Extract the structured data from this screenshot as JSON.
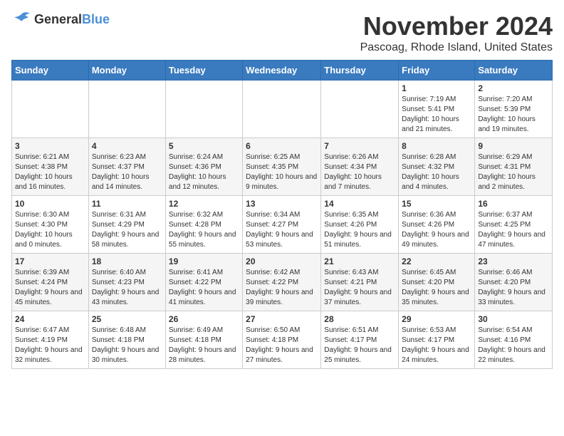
{
  "header": {
    "logo_general": "General",
    "logo_blue": "Blue",
    "month_title": "November 2024",
    "location": "Pascoag, Rhode Island, United States"
  },
  "weekdays": [
    "Sunday",
    "Monday",
    "Tuesday",
    "Wednesday",
    "Thursday",
    "Friday",
    "Saturday"
  ],
  "weeks": [
    [
      {
        "day": "",
        "info": ""
      },
      {
        "day": "",
        "info": ""
      },
      {
        "day": "",
        "info": ""
      },
      {
        "day": "",
        "info": ""
      },
      {
        "day": "",
        "info": ""
      },
      {
        "day": "1",
        "info": "Sunrise: 7:19 AM\nSunset: 5:41 PM\nDaylight: 10 hours and 21 minutes."
      },
      {
        "day": "2",
        "info": "Sunrise: 7:20 AM\nSunset: 5:39 PM\nDaylight: 10 hours and 19 minutes."
      }
    ],
    [
      {
        "day": "3",
        "info": "Sunrise: 6:21 AM\nSunset: 4:38 PM\nDaylight: 10 hours and 16 minutes."
      },
      {
        "day": "4",
        "info": "Sunrise: 6:23 AM\nSunset: 4:37 PM\nDaylight: 10 hours and 14 minutes."
      },
      {
        "day": "5",
        "info": "Sunrise: 6:24 AM\nSunset: 4:36 PM\nDaylight: 10 hours and 12 minutes."
      },
      {
        "day": "6",
        "info": "Sunrise: 6:25 AM\nSunset: 4:35 PM\nDaylight: 10 hours and 9 minutes."
      },
      {
        "day": "7",
        "info": "Sunrise: 6:26 AM\nSunset: 4:34 PM\nDaylight: 10 hours and 7 minutes."
      },
      {
        "day": "8",
        "info": "Sunrise: 6:28 AM\nSunset: 4:32 PM\nDaylight: 10 hours and 4 minutes."
      },
      {
        "day": "9",
        "info": "Sunrise: 6:29 AM\nSunset: 4:31 PM\nDaylight: 10 hours and 2 minutes."
      }
    ],
    [
      {
        "day": "10",
        "info": "Sunrise: 6:30 AM\nSunset: 4:30 PM\nDaylight: 10 hours and 0 minutes."
      },
      {
        "day": "11",
        "info": "Sunrise: 6:31 AM\nSunset: 4:29 PM\nDaylight: 9 hours and 58 minutes."
      },
      {
        "day": "12",
        "info": "Sunrise: 6:32 AM\nSunset: 4:28 PM\nDaylight: 9 hours and 55 minutes."
      },
      {
        "day": "13",
        "info": "Sunrise: 6:34 AM\nSunset: 4:27 PM\nDaylight: 9 hours and 53 minutes."
      },
      {
        "day": "14",
        "info": "Sunrise: 6:35 AM\nSunset: 4:26 PM\nDaylight: 9 hours and 51 minutes."
      },
      {
        "day": "15",
        "info": "Sunrise: 6:36 AM\nSunset: 4:26 PM\nDaylight: 9 hours and 49 minutes."
      },
      {
        "day": "16",
        "info": "Sunrise: 6:37 AM\nSunset: 4:25 PM\nDaylight: 9 hours and 47 minutes."
      }
    ],
    [
      {
        "day": "17",
        "info": "Sunrise: 6:39 AM\nSunset: 4:24 PM\nDaylight: 9 hours and 45 minutes."
      },
      {
        "day": "18",
        "info": "Sunrise: 6:40 AM\nSunset: 4:23 PM\nDaylight: 9 hours and 43 minutes."
      },
      {
        "day": "19",
        "info": "Sunrise: 6:41 AM\nSunset: 4:22 PM\nDaylight: 9 hours and 41 minutes."
      },
      {
        "day": "20",
        "info": "Sunrise: 6:42 AM\nSunset: 4:22 PM\nDaylight: 9 hours and 39 minutes."
      },
      {
        "day": "21",
        "info": "Sunrise: 6:43 AM\nSunset: 4:21 PM\nDaylight: 9 hours and 37 minutes."
      },
      {
        "day": "22",
        "info": "Sunrise: 6:45 AM\nSunset: 4:20 PM\nDaylight: 9 hours and 35 minutes."
      },
      {
        "day": "23",
        "info": "Sunrise: 6:46 AM\nSunset: 4:20 PM\nDaylight: 9 hours and 33 minutes."
      }
    ],
    [
      {
        "day": "24",
        "info": "Sunrise: 6:47 AM\nSunset: 4:19 PM\nDaylight: 9 hours and 32 minutes."
      },
      {
        "day": "25",
        "info": "Sunrise: 6:48 AM\nSunset: 4:18 PM\nDaylight: 9 hours and 30 minutes."
      },
      {
        "day": "26",
        "info": "Sunrise: 6:49 AM\nSunset: 4:18 PM\nDaylight: 9 hours and 28 minutes."
      },
      {
        "day": "27",
        "info": "Sunrise: 6:50 AM\nSunset: 4:18 PM\nDaylight: 9 hours and 27 minutes."
      },
      {
        "day": "28",
        "info": "Sunrise: 6:51 AM\nSunset: 4:17 PM\nDaylight: 9 hours and 25 minutes."
      },
      {
        "day": "29",
        "info": "Sunrise: 6:53 AM\nSunset: 4:17 PM\nDaylight: 9 hours and 24 minutes."
      },
      {
        "day": "30",
        "info": "Sunrise: 6:54 AM\nSunset: 4:16 PM\nDaylight: 9 hours and 22 minutes."
      }
    ]
  ]
}
